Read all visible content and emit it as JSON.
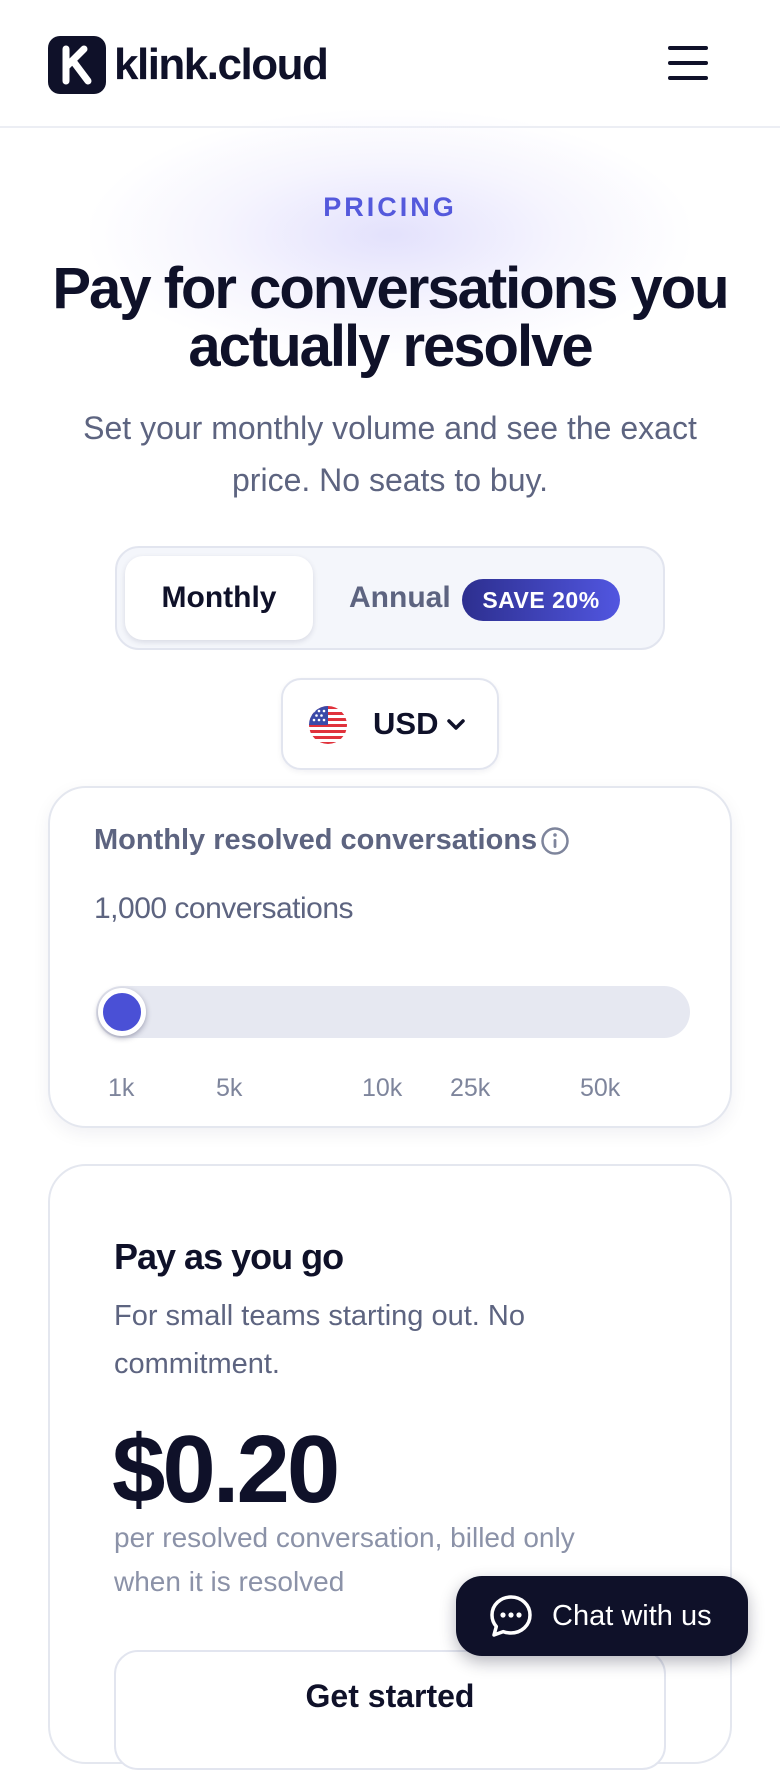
{
  "header": {
    "brand": "klink.cloud",
    "logo_letter": "K",
    "menu_icon": "hamburger-menu-icon"
  },
  "hero": {
    "eyebrow": "PRICING",
    "title": "Pay for conversations you actually resolve",
    "subtitle": "Set your monthly volume and see the exact price. No seats to buy."
  },
  "billing": {
    "options": [
      {
        "label": "Monthly",
        "selected": true
      },
      {
        "label": "Annual",
        "selected": false
      }
    ],
    "save_badge": "SAVE 20%"
  },
  "currency": {
    "selected": "USD",
    "flag_icon": "us-flag-icon"
  },
  "volume": {
    "label": "Monthly resolved conversations",
    "value_text": "1,000 conversations",
    "slider_value": 1000,
    "ticks": [
      "1k",
      "5k",
      "10k",
      "25k",
      "50k"
    ]
  },
  "plan": {
    "name": "Pay as you go",
    "description": "For small teams starting out. No commitment.",
    "price": "$0.20",
    "price_unit": "per resolved conversation, billed only when it is resolved",
    "cta_label": "Get started"
  },
  "chat": {
    "label": "Chat with us"
  },
  "colors": {
    "accent": "#4a50d6",
    "ink": "#0f1129",
    "muted": "#5d6480"
  }
}
